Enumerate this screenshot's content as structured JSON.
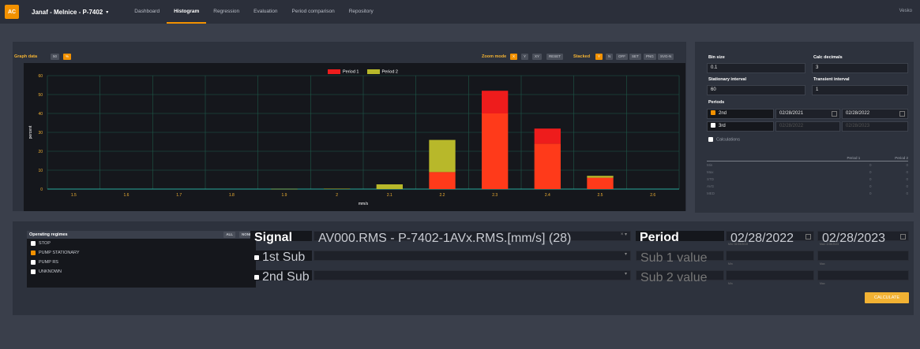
{
  "app": {
    "logo": "AC",
    "project": "Janaf - Melnice - P-7402",
    "user": "Vesko"
  },
  "nav": [
    "Dashboard",
    "Histogram",
    "Regression",
    "Evaluation",
    "Period comparison",
    "Repository"
  ],
  "graph_controls": {
    "label": "Graph data",
    "data_buttons": [
      "50",
      "%"
    ],
    "zoom_label": "Zoom mode",
    "zoom_buttons": [
      "X",
      "Y",
      "XY",
      "RESET"
    ],
    "stacked_label": "Stacked",
    "stacked_buttons": [
      "Y",
      "N",
      "OFF",
      "SET",
      "PNG",
      "SVG-N"
    ]
  },
  "chart_data": {
    "type": "bar",
    "stacked": true,
    "categories": [
      "1.5",
      "1.6",
      "1.7",
      "1.8",
      "1.9",
      "2",
      "2.1",
      "2.2",
      "2.3",
      "2.4",
      "2.5",
      "2.6"
    ],
    "series": [
      {
        "name": "Period 1",
        "values": [
          0,
          0,
          0,
          0,
          0,
          0,
          0,
          9,
          40,
          24,
          6,
          0
        ],
        "color": "#ff3a1a"
      },
      {
        "name": "Period 2",
        "values": [
          0,
          0,
          0,
          0,
          0.1,
          0.2,
          2.5,
          17,
          0,
          0,
          1,
          0
        ],
        "color": "#b8b82a"
      },
      {
        "name": "Period 1",
        "values": [
          0,
          0,
          0,
          0,
          0,
          0,
          0,
          0,
          12,
          8,
          0,
          0
        ],
        "color": "#ee1c1c"
      }
    ],
    "yticks": [
      "0",
      "10",
      "20",
      "30",
      "40",
      "50",
      "60"
    ],
    "ylim": [
      0,
      60
    ],
    "xlabel": "mm/s",
    "ylabel": "percent",
    "grid": true,
    "legend": "top-center"
  },
  "settings": {
    "bin_size_label": "Bin size",
    "bin_size": "0.1",
    "calc_decimals_label": "Calc decimals",
    "calc_decimals": "3",
    "stationary_label": "Stationary interval",
    "stationary": "60",
    "transient_label": "Transient interval",
    "transient": "1",
    "periods_label": "Periods",
    "period_rows": [
      {
        "label": "2nd",
        "checked": true,
        "from": "02/28/2021",
        "to": "02/28/2022"
      },
      {
        "label": "3rd",
        "checked": false,
        "from": "02/28/2022",
        "to": "02/28/2023"
      }
    ],
    "calculations_label": "Calculations",
    "calc_headers": [
      "Period 1",
      "Period 2"
    ],
    "calc_rows": [
      {
        "name": "Min",
        "p1": "0",
        "p2": "0"
      },
      {
        "name": "Max",
        "p1": "0",
        "p2": "0"
      },
      {
        "name": "STD",
        "p1": "0",
        "p2": "0"
      },
      {
        "name": "AVG",
        "p1": "0",
        "p2": "0"
      },
      {
        "name": "MED",
        "p1": "0",
        "p2": "0"
      }
    ]
  },
  "operating": {
    "title": "Operating regimes",
    "buttons": [
      "ALL",
      "NONE"
    ],
    "items": [
      {
        "label": "STOP",
        "checked": false
      },
      {
        "label": "PUMP STATIONARY",
        "checked": true
      },
      {
        "label": "PUMP RS",
        "checked": false
      },
      {
        "label": "UNKNOWN",
        "checked": false
      }
    ]
  },
  "signal": {
    "label": "Signal",
    "value": "AV000.RMS - P-7402-1AVx.RMS.[mm/s] (28)",
    "sub1_label": "1st Sub",
    "sub2_label": "2nd Sub"
  },
  "period": {
    "label": "Period",
    "from": "02/28/2022",
    "to": "02/28/2023",
    "from_hint": "Min: 02/19/2019",
    "to_hint": "Max: 2/28/2023",
    "sub1_label": "Sub 1 value",
    "sub2_label": "Sub 2 value",
    "min_hint": "Min",
    "max_hint": "Max"
  },
  "calculate_label": "CALCULATE"
}
